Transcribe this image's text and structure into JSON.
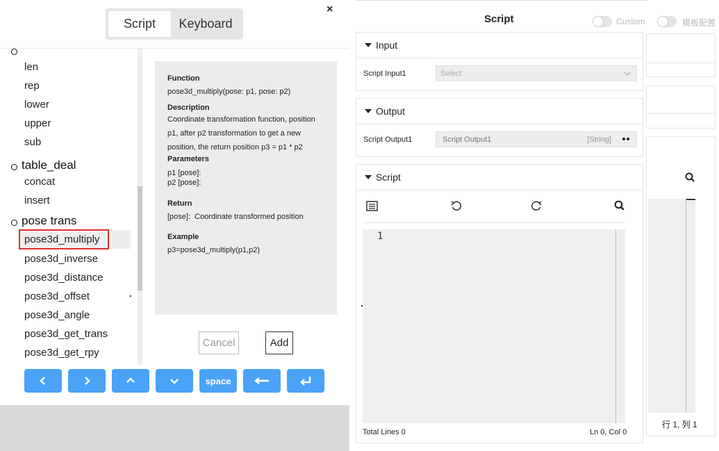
{
  "modal": {
    "tabs": [
      "Script",
      "Keyboard"
    ],
    "close": "×",
    "groups": [
      {
        "label": "",
        "items": [
          "len",
          "rep",
          "lower",
          "upper",
          "sub"
        ]
      },
      {
        "label": "table_deal",
        "items": [
          "concat",
          "insert"
        ]
      },
      {
        "label": "pose trans",
        "items": [
          "pose3d_multiply",
          "pose3d_inverse",
          "pose3d_distance",
          "pose3d_offset",
          "pose3d_angle",
          "pose3d_get_trans",
          "pose3d_get_rpy"
        ]
      }
    ],
    "selected_item": "pose3d_multiply",
    "detail": {
      "function_heading": "Function",
      "function_sig": "pose3d_multiply(pose: p1, pose: p2)",
      "description_heading": "Description",
      "description_lines": [
        "Coordinate transformation function, position",
        "p1, after p2 transformation to get a new",
        "position, the return position p3 = p1 * p2"
      ],
      "parameters_heading": "Parameters",
      "param_lines": [
        "p1 [pose]:",
        "p2 [pose]:"
      ],
      "return_heading": "Return",
      "return_type": "[pose]:",
      "return_desc": "Coordinate transformed position",
      "example_heading": "Example",
      "example": "p3=pose3d_multiply(p1,p2)"
    },
    "buttons": {
      "cancel": "Cancel",
      "add": "Add"
    },
    "keys": {
      "space": "space"
    }
  },
  "panel": {
    "title": "Script",
    "toggle_custom": "Custom",
    "toggle_template": "模板配置",
    "input_section": {
      "title": "Input",
      "label": "Script Input1",
      "placeholder": "Select"
    },
    "output_section": {
      "title": "Output",
      "label": "Script Output1",
      "value": "Script Output1",
      "type": "[String]"
    },
    "script_section": {
      "title": "Script",
      "line_number": "1",
      "total_lines": "Total Lines 0",
      "cursor": "Ln 0, Col 0"
    },
    "ghost_status": "行 1, 列 1"
  },
  "colors": {
    "accent": "#4aa3f6",
    "highlight_border": "#e0302e"
  }
}
